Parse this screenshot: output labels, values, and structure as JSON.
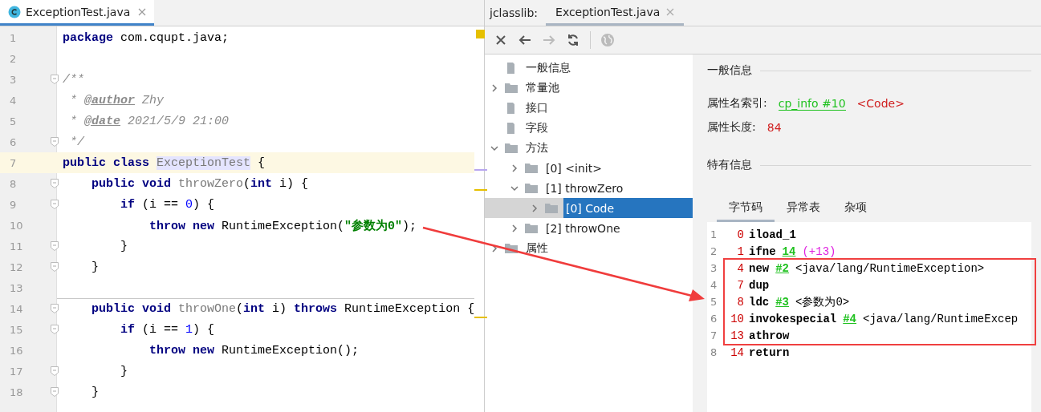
{
  "editor": {
    "tab": {
      "title": "ExceptionTest.java",
      "selected": true
    },
    "lines": [
      {
        "number": "1",
        "fold_marker": false,
        "current": false,
        "separator_above": false,
        "tokens": [
          {
            "kind": "kw",
            "text": "package"
          },
          {
            "kind": "plain",
            "text": " com.cqupt.java;"
          }
        ]
      },
      {
        "number": "2",
        "fold_marker": false,
        "current": false,
        "separator_above": false
      },
      {
        "number": "3",
        "fold_marker": true,
        "current": false,
        "separator_above": false,
        "tokens": [
          {
            "kind": "doc",
            "text": "/**"
          }
        ]
      },
      {
        "number": "4",
        "fold_marker": false,
        "current": false,
        "separator_above": false,
        "tokens": [
          {
            "kind": "doc",
            "text": " * "
          },
          {
            "kind": "doctag",
            "text": "@author"
          },
          {
            "kind": "doc",
            "text": " Zhy"
          }
        ]
      },
      {
        "number": "5",
        "fold_marker": false,
        "current": false,
        "separator_above": false,
        "tokens": [
          {
            "kind": "doc",
            "text": " * "
          },
          {
            "kind": "doctag",
            "text": "@date"
          },
          {
            "kind": "doc",
            "text": " 2021/5/9 21:00"
          }
        ]
      },
      {
        "number": "6",
        "fold_marker": true,
        "current": false,
        "separator_above": false,
        "tokens": [
          {
            "kind": "doc",
            "text": " */"
          }
        ]
      },
      {
        "number": "7",
        "fold_marker": false,
        "current": true,
        "separator_above": false,
        "tokens": [
          {
            "kind": "kw",
            "text": "public class "
          },
          {
            "kind": "decl_hl",
            "text": "ExceptionTest"
          },
          {
            "kind": "plain",
            "text": " {"
          }
        ]
      },
      {
        "number": "8",
        "fold_marker": true,
        "current": false,
        "separator_above": false,
        "tokens": [
          {
            "kind": "kw",
            "text": "    public void "
          },
          {
            "kind": "decl",
            "text": "throwZero"
          },
          {
            "kind": "plain",
            "text": "("
          },
          {
            "kind": "kw",
            "text": "int"
          },
          {
            "kind": "plain",
            "text": " i) {"
          }
        ]
      },
      {
        "number": "9",
        "fold_marker": true,
        "current": false,
        "separator_above": false,
        "tokens": [
          {
            "kind": "kw",
            "text": "        if"
          },
          {
            "kind": "plain",
            "text": " (i == "
          },
          {
            "kind": "num",
            "text": "0"
          },
          {
            "kind": "plain",
            "text": ") {"
          }
        ]
      },
      {
        "number": "10",
        "fold_marker": false,
        "current": false,
        "separator_above": false,
        "tokens": [
          {
            "kind": "kw",
            "text": "            throw new"
          },
          {
            "kind": "plain",
            "text": " RuntimeException("
          },
          {
            "kind": "str",
            "text": "\"参数为0\""
          },
          {
            "kind": "plain",
            "text": ");"
          }
        ]
      },
      {
        "number": "11",
        "fold_marker": true,
        "current": false,
        "separator_above": false,
        "tokens": [
          {
            "kind": "plain",
            "text": "        }"
          }
        ]
      },
      {
        "number": "12",
        "fold_marker": true,
        "current": false,
        "separator_above": false,
        "tokens": [
          {
            "kind": "plain",
            "text": "    }"
          }
        ]
      },
      {
        "number": "13",
        "fold_marker": false,
        "current": false,
        "separator_above": false
      },
      {
        "number": "14",
        "fold_marker": true,
        "current": false,
        "separator_above": true,
        "tokens": [
          {
            "kind": "kw",
            "text": "    public void "
          },
          {
            "kind": "decl",
            "text": "throwOne"
          },
          {
            "kind": "plain",
            "text": "("
          },
          {
            "kind": "kw",
            "text": "int"
          },
          {
            "kind": "plain",
            "text": " i) "
          },
          {
            "kind": "kw",
            "text": "throws"
          },
          {
            "kind": "plain",
            "text": " RuntimeException {"
          }
        ]
      },
      {
        "number": "15",
        "fold_marker": true,
        "current": false,
        "separator_above": false,
        "tokens": [
          {
            "kind": "kw",
            "text": "        if"
          },
          {
            "kind": "plain",
            "text": " (i == "
          },
          {
            "kind": "num",
            "text": "1"
          },
          {
            "kind": "plain",
            "text": ") {"
          }
        ]
      },
      {
        "number": "16",
        "fold_marker": false,
        "current": false,
        "separator_above": false,
        "tokens": [
          {
            "kind": "kw",
            "text": "            throw new"
          },
          {
            "kind": "plain",
            "text": " RuntimeException();"
          }
        ]
      },
      {
        "number": "17",
        "fold_marker": true,
        "current": false,
        "separator_above": false,
        "tokens": [
          {
            "kind": "plain",
            "text": "        }"
          }
        ]
      },
      {
        "number": "18",
        "fold_marker": true,
        "current": false,
        "separator_above": false,
        "tokens": [
          {
            "kind": "plain",
            "text": "    }"
          }
        ]
      }
    ]
  },
  "jclasslib": {
    "label": "jclasslib:",
    "tab": {
      "title": "ExceptionTest.java",
      "selected": true
    },
    "toolbar": [
      {
        "kind": "close",
        "disabled": false
      },
      {
        "kind": "back",
        "disabled": false
      },
      {
        "kind": "forward",
        "disabled": true
      },
      {
        "kind": "refresh",
        "disabled": false
      },
      {
        "kind": "sep"
      },
      {
        "kind": "web",
        "disabled": true
      }
    ],
    "tree": [
      {
        "label": "一般信息",
        "kind": "file",
        "selected": false
      },
      {
        "label": "常量池",
        "kind": "folder",
        "expanded": false,
        "selected": false
      },
      {
        "label": "接口",
        "kind": "file",
        "selected": false
      },
      {
        "label": "字段",
        "kind": "file",
        "selected": false
      },
      {
        "label": "方法",
        "kind": "folder",
        "expanded": true,
        "selected": false,
        "children": [
          {
            "label": "[0] <init>",
            "kind": "folder",
            "expanded": false,
            "selected": false
          },
          {
            "label": "[1] throwZero",
            "kind": "folder",
            "expanded": true,
            "selected": false,
            "children": [
              {
                "label": "[0] Code",
                "kind": "folder",
                "expanded": false,
                "selected": true
              }
            ]
          },
          {
            "label": "[2] throwOne",
            "kind": "folder",
            "expanded": false,
            "selected": false
          }
        ]
      },
      {
        "label": "属性",
        "kind": "folder",
        "expanded": false,
        "selected": false
      }
    ],
    "general": {
      "heading": "一般信息",
      "rows": [
        {
          "label": "属性名索引:",
          "kind": "link",
          "value": "cp_info #10",
          "extra": "<Code>"
        },
        {
          "label": "属性长度:",
          "kind": "number",
          "value": "84"
        }
      ]
    },
    "specific": {
      "heading": "特有信息",
      "tabs": [
        {
          "label": "字节码",
          "selected": true
        },
        {
          "label": "异常表",
          "selected": false
        },
        {
          "label": "杂项",
          "selected": false
        }
      ],
      "bytecode": [
        {
          "number": "1",
          "pc": "0",
          "op": "iload_1",
          "boxed": false
        },
        {
          "number": "2",
          "pc": "1",
          "op": "ifne",
          "boxed": false,
          "args": [
            {
              "kind": "ref",
              "text": "14"
            },
            {
              "kind": "jump",
              "text": "(+13)"
            }
          ]
        },
        {
          "number": "3",
          "pc": "4",
          "op": "new",
          "boxed": true,
          "args": [
            {
              "kind": "ref",
              "text": "#2"
            },
            {
              "kind": "text",
              "text": "<java/lang/RuntimeException>"
            }
          ]
        },
        {
          "number": "4",
          "pc": "7",
          "op": "dup",
          "boxed": true
        },
        {
          "number": "5",
          "pc": "8",
          "op": "ldc",
          "boxed": true,
          "args": [
            {
              "kind": "ref",
              "text": "#3"
            },
            {
              "kind": "text",
              "text": "<参数为0>"
            }
          ]
        },
        {
          "number": "6",
          "pc": "10",
          "op": "invokespecial",
          "boxed": true,
          "args": [
            {
              "kind": "ref",
              "text": "#4"
            },
            {
              "kind": "text",
              "text": "<java/lang/RuntimeExcep"
            }
          ]
        },
        {
          "number": "7",
          "pc": "13",
          "op": "athrow",
          "boxed": true
        },
        {
          "number": "8",
          "pc": "14",
          "op": "return",
          "boxed": false
        }
      ]
    }
  },
  "callout_arrow": true
}
